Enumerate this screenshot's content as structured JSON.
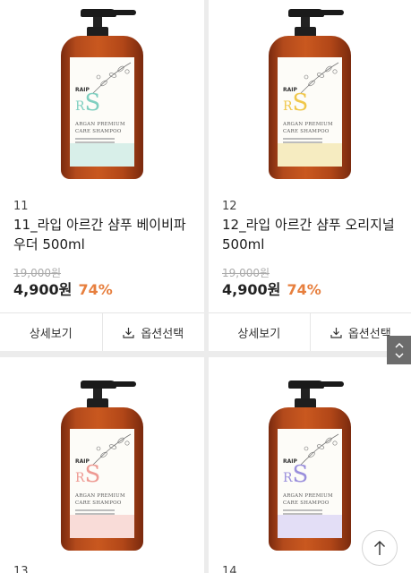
{
  "products": [
    {
      "number": "11",
      "name": "11_라입 아르간 샴푸 베이비파우더 500ml",
      "original_price": "19,000원",
      "price": "4,900원",
      "discount": "74%",
      "detail_label": "상세보기",
      "option_label": "옵션선택",
      "label": {
        "brand": "RAIP",
        "logo_r": "R",
        "logo_s": "S",
        "line1": "ARGAN PREMIUM",
        "line2": "CARE SHAMPOO"
      },
      "theme": "mint"
    },
    {
      "number": "12",
      "name": "12_라입 아르간 샴푸 오리지널 500ml",
      "original_price": "19,000원",
      "price": "4,900원",
      "discount": "74%",
      "detail_label": "상세보기",
      "option_label": "옵션선택",
      "label": {
        "brand": "RAIP",
        "logo_r": "R",
        "logo_s": "S",
        "line1": "ARGAN PREMIUM",
        "line2": "CARE SHAMPOO"
      },
      "theme": "yellow"
    },
    {
      "number": "13",
      "label": {
        "brand": "RAIP",
        "logo_r": "R",
        "logo_s": "S",
        "line1": "ARGAN PREMIUM",
        "line2": "CARE SHAMPOO"
      },
      "theme": "pink"
    },
    {
      "number": "14",
      "label": {
        "brand": "RAIP",
        "logo_r": "R",
        "logo_s": "S",
        "line1": "ARGAN PREMIUM",
        "line2": "CARE SHAMPOO"
      },
      "theme": "lilac"
    }
  ],
  "colors": {
    "discount": "#e77f3e",
    "page_background": "#ececec",
    "bottle": "#c9581f",
    "mint": "#7fcfc0",
    "yellow": "#f0c74a",
    "pink": "#ee9a93",
    "lilac": "#9a8fdc"
  },
  "icons": {
    "option": "download-icon",
    "scroll_up": "chevron-up-icon",
    "scroll_down": "chevron-down-icon",
    "back_to_top": "arrow-up-icon"
  }
}
